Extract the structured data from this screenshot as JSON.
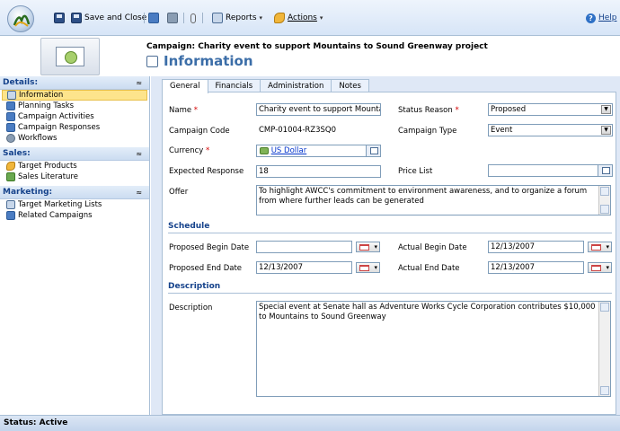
{
  "toolbar": {
    "save_and_close": "Save and Close",
    "reports": "Reports",
    "actions": "Actions",
    "help": "Help"
  },
  "header": {
    "entity_title": "Campaign: Charity event to support Mountains to Sound Greenway project",
    "form_title": "Information"
  },
  "nav": {
    "details": {
      "label": "Details:",
      "items": [
        "Information",
        "Planning Tasks",
        "Campaign Activities",
        "Campaign Responses",
        "Workflows"
      ]
    },
    "sales": {
      "label": "Sales:",
      "items": [
        "Target Products",
        "Sales Literature"
      ]
    },
    "marketing": {
      "label": "Marketing:",
      "items": [
        "Target Marketing Lists",
        "Related Campaigns"
      ]
    }
  },
  "tabs": [
    "General",
    "Financials",
    "Administration",
    "Notes"
  ],
  "form": {
    "name_label": "Name",
    "name_value": "Charity event to support Mountain",
    "campaign_code_label": "Campaign Code",
    "campaign_code_value": "CMP-01004-RZ3SQ0",
    "currency_label": "Currency",
    "currency_value": "US Dollar",
    "expected_response_label": "Expected Response",
    "expected_response_value": "18",
    "offer_label": "Offer",
    "offer_value": "To highlight AWCC's commitment to environment awareness, and to organize a forum from where further leads can be generated",
    "status_reason_label": "Status Reason",
    "status_reason_value": "Proposed",
    "campaign_type_label": "Campaign Type",
    "campaign_type_value": "Event",
    "price_list_label": "Price List",
    "price_list_value": "",
    "required_mark": "*"
  },
  "schedule": {
    "section_label": "Schedule",
    "proposed_begin_label": "Proposed Begin Date",
    "proposed_begin_value": "",
    "proposed_end_label": "Proposed End Date",
    "proposed_end_value": "12/13/2007",
    "actual_begin_label": "Actual Begin Date",
    "actual_begin_value": "12/13/2007",
    "actual_end_label": "Actual End Date",
    "actual_end_value": "12/13/2007"
  },
  "description": {
    "section_label": "Description",
    "label": "Description",
    "value": "Special event at Senate hall as Adventure Works Cycle Corporation contributes $10,000 to Mountains to Sound Greenway"
  },
  "status": "Status: Active"
}
